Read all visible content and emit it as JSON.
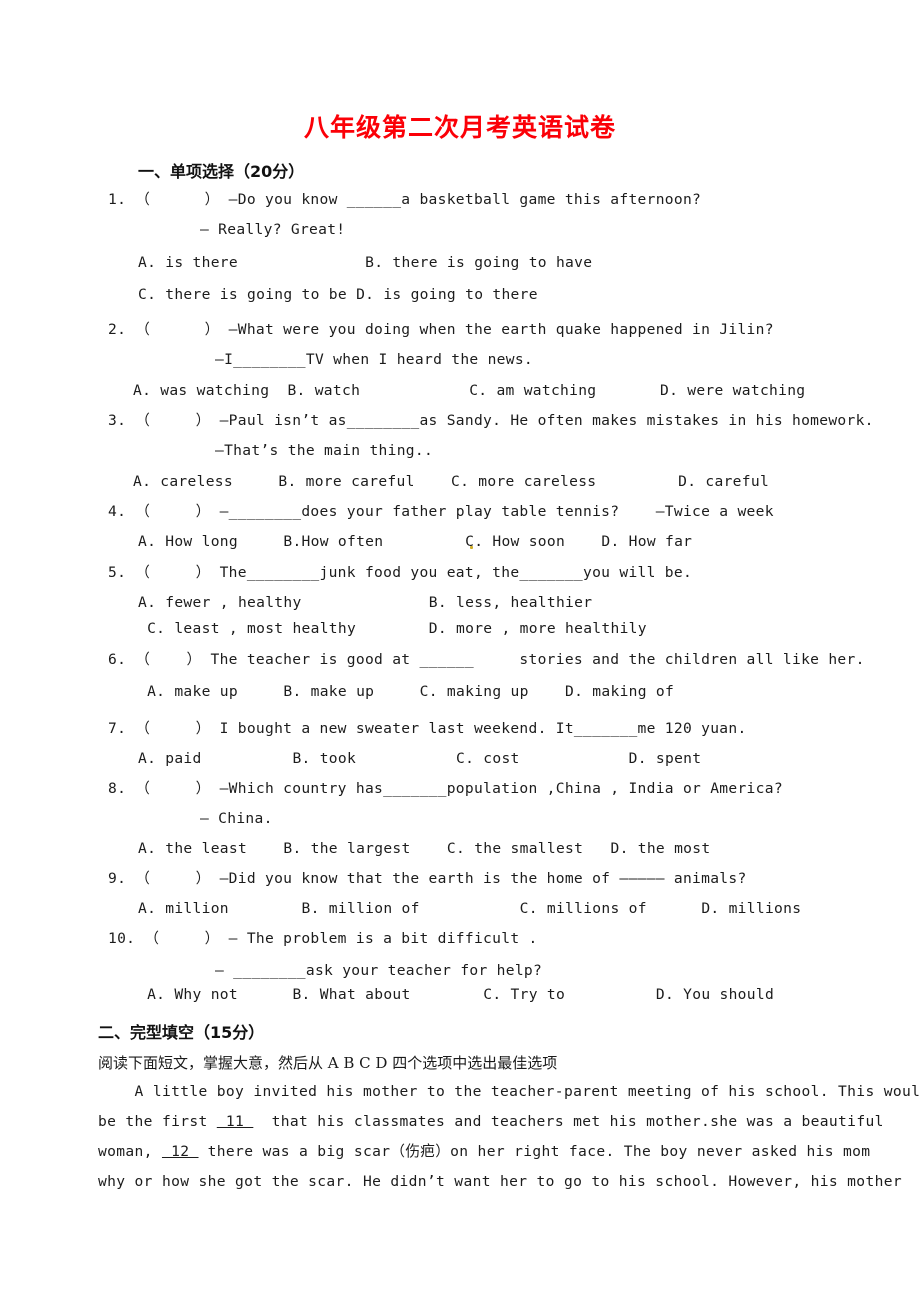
{
  "document": {
    "title": "八年级第二次月考英语试卷",
    "title_color": "#fb0007"
  },
  "section1": {
    "heading": "一、单项选择（20分）",
    "questions": [
      {
        "number": "1.",
        "stem_lines": [
          "1. （      ） —Do you know ______a basketball game this afternoon?",
          "— Really? Great!"
        ],
        "option_lines": [
          "A. is there              B. there is going to have",
          "C. there is going to be D. is going to there"
        ]
      },
      {
        "number": "2.",
        "stem_lines": [
          "2. （      ） —What were you doing when the earth quake happened in Jilin?",
          "—I________TV when I heard the news."
        ],
        "option_lines": [
          "A. was watching  B. watch            C. am watching       D. were watching"
        ]
      },
      {
        "number": "3.",
        "stem_lines": [
          "3. （     ） —Paul isn’t as________as Sandy. He often makes mistakes in his homework.",
          "—That’s the main thing.."
        ],
        "option_lines": [
          "A. careless     B. more careful    C. more careless         D. careful"
        ]
      },
      {
        "number": "4.",
        "stem_lines": [
          "4. （     ） —________does your father play table tennis?    —Twice a week"
        ],
        "option_lines": [
          "A. How long     B.How often         C. How soon    D. How far"
        ]
      },
      {
        "number": "5.",
        "stem_lines": [
          "5. （     ） The________junk food you eat, the_______you will be."
        ],
        "option_lines": [
          "A. fewer , healthy              B. less, healthier",
          " C. least , most healthy        D. more , more healthily"
        ]
      },
      {
        "number": "6.",
        "stem_lines": [
          "6. （    ） The teacher is good at ______     stories and the children all like her."
        ],
        "option_lines": [
          " A. make up     B. make up     C. making up    D. making of"
        ]
      },
      {
        "number": "7.",
        "stem_lines": [
          "7. （     ） I bought a new sweater last weekend. It_______me 120 yuan."
        ],
        "option_lines": [
          "A. paid          B. took           C. cost            D. spent"
        ]
      },
      {
        "number": "8.",
        "stem_lines": [
          "8. （     ） —Which country has_______population ,China , India or America?",
          "— China."
        ],
        "option_lines": [
          "A. the least    B. the largest    C. the smallest   D. the most"
        ]
      },
      {
        "number": "9.",
        "stem_lines": [
          "9. （     ） —Did you know that the earth is the home of ————— animals?"
        ],
        "option_lines": [
          "A. million        B. million of           C. millions of      D. millions"
        ]
      },
      {
        "number": "10.",
        "stem_lines": [
          "10. （     ） — The problem is a bit difficult .",
          "— ________ask your teacher for help?"
        ],
        "option_lines": [
          " A. Why not      B. What about        C. Try to          D. You should"
        ]
      }
    ]
  },
  "section2": {
    "heading": "二、完型填空（15分）",
    "instruction": "阅读下面短文，掌握大意，然后从 A B C D 四个选项中选出最佳选项",
    "passage_lines": [
      "    A little boy invited his mother to the teacher-parent meeting of his school. This would",
      "be the first  11   that his classmates and teachers met his mother.she was a beautiful",
      "woman,  12  there was a big scar（伤疤）on her right face. The boy never asked his mom",
      "why or how she got the scar. He didn’t want her to go to his school. However, his mother"
    ],
    "blanks": [
      "11",
      "12"
    ]
  }
}
